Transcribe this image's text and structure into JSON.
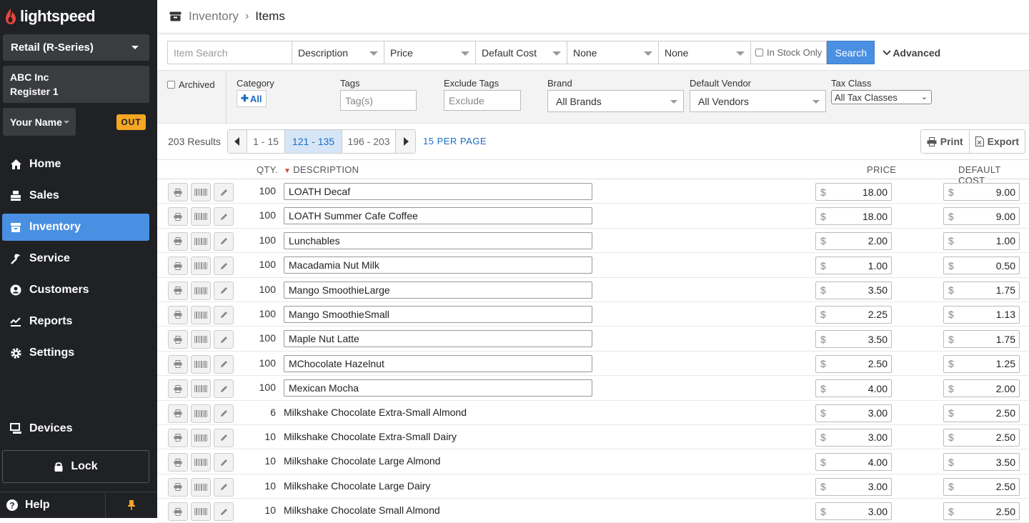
{
  "app": {
    "logo_text": "lightspeed"
  },
  "sidebar": {
    "store": "Retail (R-Series)",
    "company": "ABC Inc",
    "register": "Register 1",
    "user": "Your Name",
    "clock_badge": "OUT",
    "nav": [
      {
        "label": "Home",
        "icon": "home-icon"
      },
      {
        "label": "Sales",
        "icon": "sales-icon"
      },
      {
        "label": "Inventory",
        "icon": "inventory-icon",
        "active": true
      },
      {
        "label": "Service",
        "icon": "service-icon"
      },
      {
        "label": "Customers",
        "icon": "customers-icon"
      },
      {
        "label": "Reports",
        "icon": "reports-icon"
      },
      {
        "label": "Settings",
        "icon": "settings-icon"
      }
    ],
    "devices": "Devices",
    "lock": "Lock",
    "help": "Help"
  },
  "breadcrumb": {
    "parent": "Inventory",
    "current": "Items"
  },
  "search": {
    "item_placeholder": "Item Search",
    "description_field": "Description",
    "price_field": "Price",
    "default_cost_field": "Default Cost",
    "none1": "None",
    "none2": "None",
    "in_stock_only": "In Stock Only",
    "search_button": "Search",
    "advanced": "Advanced"
  },
  "filters": {
    "archived": "Archived",
    "category_label": "Category",
    "category_all": "All",
    "tags_label": "Tags",
    "tags_placeholder": "Tag(s)",
    "exclude_tags_label": "Exclude Tags",
    "exclude_placeholder": "Exclude",
    "brand_label": "Brand",
    "brand_value": "All Brands",
    "vendor_label": "Default Vendor",
    "vendor_value": "All Vendors",
    "tax_label": "Tax Class",
    "tax_value": "All Tax Classes"
  },
  "pager": {
    "results": "203 Results",
    "pages": [
      "1 - 15",
      "121 - 135",
      "196 - 203"
    ],
    "current_page_index": 1,
    "per_page": "15 PER PAGE",
    "print": "Print",
    "export": "Export"
  },
  "table": {
    "headers": {
      "qty": "QTY.",
      "description": "DESCRIPTION",
      "price": "PRICE",
      "default_cost": "DEFAULT COST"
    },
    "currency": "$",
    "rows": [
      {
        "qty": "100",
        "description": "LOATH Decaf",
        "price": "18.00",
        "cost": "9.00",
        "editable": true
      },
      {
        "qty": "100",
        "description": "LOATH Summer Cafe Coffee",
        "price": "18.00",
        "cost": "9.00",
        "editable": true
      },
      {
        "qty": "100",
        "description": "Lunchables",
        "price": "2.00",
        "cost": "1.00",
        "editable": true
      },
      {
        "qty": "100",
        "description": "Macadamia Nut Milk",
        "price": "1.00",
        "cost": "0.50",
        "editable": true
      },
      {
        "qty": "100",
        "description": "Mango SmoothieLarge",
        "price": "3.50",
        "cost": "1.75",
        "editable": true
      },
      {
        "qty": "100",
        "description": "Mango SmoothieSmall",
        "price": "2.25",
        "cost": "1.13",
        "editable": true
      },
      {
        "qty": "100",
        "description": "Maple Nut Latte",
        "price": "3.50",
        "cost": "1.75",
        "editable": true
      },
      {
        "qty": "100",
        "description": "MChocolate Hazelnut",
        "price": "2.50",
        "cost": "1.25",
        "editable": true
      },
      {
        "qty": "100",
        "description": "Mexican Mocha",
        "price": "4.00",
        "cost": "2.00",
        "editable": true
      },
      {
        "qty": "6",
        "description": "Milkshake Chocolate Extra-Small Almond",
        "price": "3.00",
        "cost": "2.50",
        "editable": false
      },
      {
        "qty": "10",
        "description": "Milkshake Chocolate Extra-Small Dairy",
        "price": "3.00",
        "cost": "2.50",
        "editable": false
      },
      {
        "qty": "10",
        "description": "Milkshake Chocolate Large Almond",
        "price": "4.00",
        "cost": "3.50",
        "editable": false
      },
      {
        "qty": "10",
        "description": "Milkshake Chocolate Large Dairy",
        "price": "3.00",
        "cost": "2.50",
        "editable": false
      },
      {
        "qty": "10",
        "description": "Milkshake Chocolate Small Almond",
        "price": "3.00",
        "cost": "2.50",
        "editable": false
      }
    ]
  },
  "colors": {
    "sidebar_bg": "#1f2124",
    "accent": "#4a90e2",
    "badge": "#f5a623",
    "link": "#1a6dc4"
  }
}
